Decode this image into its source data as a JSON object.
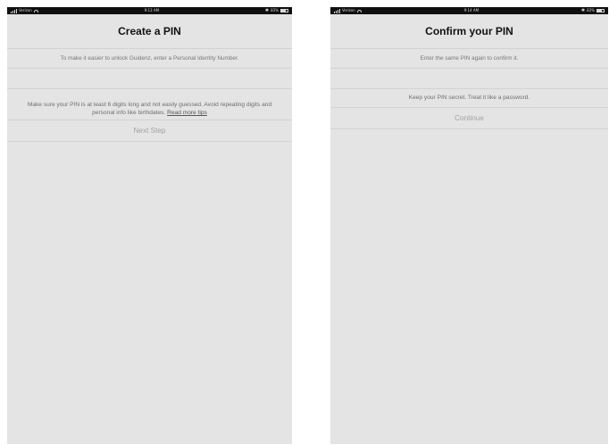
{
  "screens": [
    {
      "status": {
        "carrier": "Verizon",
        "time": "9:13 AM",
        "battery": "83%"
      },
      "title": "Create a PIN",
      "instruction": "To make it easier to unlock Guidenz, enter a Personal Identity Number.",
      "pin_value": "",
      "tip_text": "Make sure your PIN is at least 6 digits long and not easily guessed. Avoid repeating digits and personal info like birthdates.",
      "tip_link": "Read more tips",
      "action_label": "Next Step"
    },
    {
      "status": {
        "carrier": "Verizon",
        "time": "9:14 AM",
        "battery": "83%"
      },
      "title": "Confirm your PIN",
      "instruction": "Enter the same PIN again to confirm it.",
      "pin_value": "",
      "tip_text": "Keep your PIN secret. Treat it like a password.",
      "action_label": "Continue"
    }
  ]
}
